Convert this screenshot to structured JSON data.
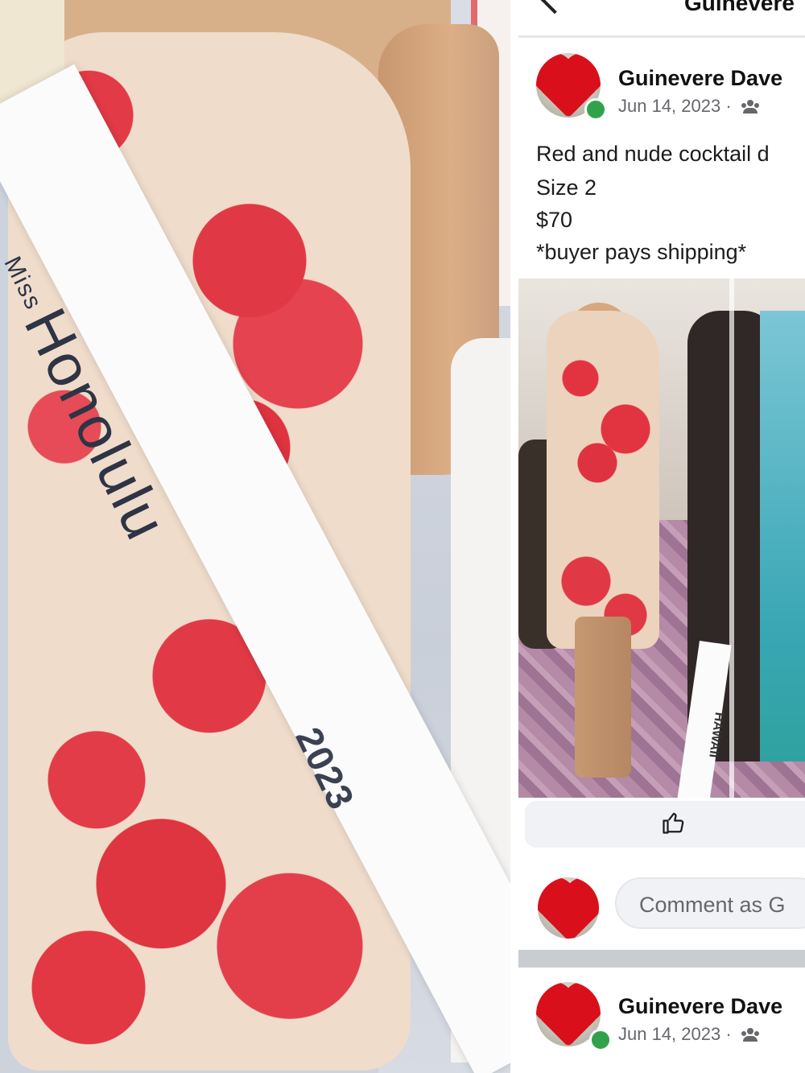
{
  "left_photo": {
    "sash_prefix": "Miss",
    "sash_text": "Honolulu",
    "sash_year": "2023",
    "colors": {
      "lace": "#e23a46",
      "nude": "#efdccb",
      "sash": "#fbfbfb"
    }
  },
  "header": {
    "title": "Guinevere",
    "back_icon": "chevron-left-icon"
  },
  "post": {
    "author": "Guinevere Dave",
    "date": "Jun 14, 2023",
    "separator": "·",
    "audience_icon": "group-icon",
    "lines": [
      "Red and nude cocktail d",
      "Size 2",
      "$70",
      "*buyer pays shipping*"
    ],
    "photo_sash_text": "HAWAII",
    "like_icon": "thumbs-up-icon"
  },
  "comment": {
    "placeholder": "Comment as G"
  },
  "next_post": {
    "author": "Guinevere Dave",
    "date": "Jun 14, 2023",
    "separator": "·"
  },
  "colors": {
    "online": "#31a24c",
    "meta_text": "#65676b",
    "input_bg": "#f0f2f5"
  }
}
